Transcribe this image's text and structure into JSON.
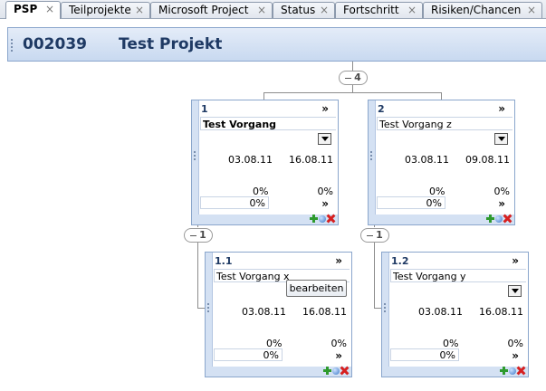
{
  "tabs": [
    {
      "label": "PSP",
      "active": true
    },
    {
      "label": "Teilprojekte"
    },
    {
      "label": "Microsoft Project"
    },
    {
      "label": "Status"
    },
    {
      "label": "Fortschritt"
    },
    {
      "label": "Risiken/Chancen"
    }
  ],
  "tab_close_glyph": "×",
  "header": {
    "code": "002039",
    "title": "Test Projekt"
  },
  "collapse": {
    "root_count": "4",
    "child1_count": "1",
    "child2_count": "1"
  },
  "tooltip": "bearbeiten",
  "expand_glyph": "»",
  "cards": [
    {
      "number": "1",
      "name": "Test Vorgang",
      "start": "03.08.11",
      "end": "16.08.11",
      "pct1": "0%",
      "pct2": "0%",
      "pct_input": "0%"
    },
    {
      "number": "2",
      "name": "Test Vorgang z",
      "start": "03.08.11",
      "end": "09.08.11",
      "pct1": "0%",
      "pct2": "0%",
      "pct_input": "0%"
    },
    {
      "number": "1.1",
      "name": "Test Vorgang x",
      "start": "03.08.11",
      "end": "16.08.11",
      "pct1": "0%",
      "pct2": "0%",
      "pct_input": "0%"
    },
    {
      "number": "1.2",
      "name": "Test Vorgang y",
      "start": "03.08.11",
      "end": "16.08.11",
      "pct1": "0%",
      "pct2": "0%",
      "pct_input": "0%"
    }
  ],
  "icons": [
    "add-icon",
    "status-icon",
    "delete-icon"
  ]
}
